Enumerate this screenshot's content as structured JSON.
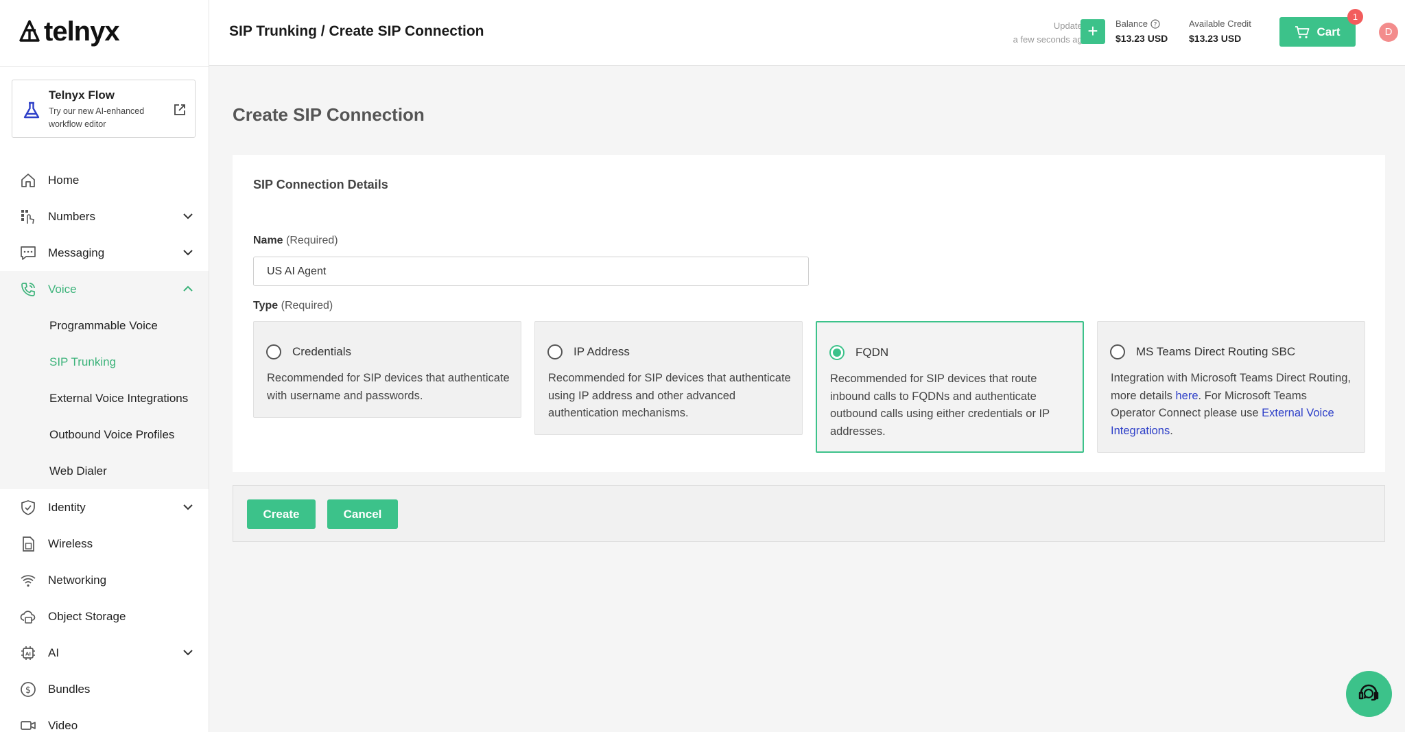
{
  "brand": {
    "name": "telnyx",
    "accent": "#3cc28a",
    "link_color": "#2d3fc8"
  },
  "flow_card": {
    "title": "Telnyx Flow",
    "subtitle": "Try our new AI-enhanced workflow editor",
    "icon": "flask-icon"
  },
  "sidebar": {
    "items": [
      {
        "label": "Home",
        "icon": "home-icon"
      },
      {
        "label": "Numbers",
        "icon": "numbers-icon"
      },
      {
        "label": "Messaging",
        "icon": "message-icon"
      },
      {
        "label": "Voice",
        "icon": "phone-icon"
      },
      {
        "label": "Identity",
        "icon": "shield-check-icon"
      },
      {
        "label": "Wireless",
        "icon": "sim-card-icon"
      },
      {
        "label": "Networking",
        "icon": "wifi-icon"
      },
      {
        "label": "Object Storage",
        "icon": "storage-icon"
      },
      {
        "label": "AI",
        "icon": "ai-chip-icon"
      },
      {
        "label": "Bundles",
        "icon": "dollar-circle-icon"
      },
      {
        "label": "Video",
        "icon": "video-icon"
      }
    ],
    "voice_sub": [
      "Programmable Voice",
      "SIP Trunking",
      "External Voice Integrations",
      "Outbound Voice Profiles",
      "Web Dialer"
    ]
  },
  "topbar": {
    "breadcrumb": "SIP Trunking / Create SIP Connection",
    "updated_label": "Updated",
    "updated_value": "a few seconds ago",
    "add_funds": "+",
    "balance_label": "Balance",
    "balance_value": "$13.23 USD",
    "credit_label": "Available Credit",
    "credit_value": "$13.23 USD",
    "cart_label": "Cart",
    "cart_count": "1",
    "avatar_initial": "D"
  },
  "main": {
    "page_title": "Create SIP Connection",
    "section_title": "SIP Connection Details",
    "name_label": "Name",
    "name_required": "(Required)",
    "name_value": "US AI Agent",
    "type_label": "Type",
    "type_required": "(Required)",
    "selected_type": "FQDN",
    "types": [
      {
        "title": "Credentials",
        "desc": "Recommended for SIP devices that authenticate with username and passwords."
      },
      {
        "title": "IP Address",
        "desc": "Recommended for SIP devices that authenticate using IP address and other advanced authentication mechanisms."
      },
      {
        "title": "FQDN",
        "desc": "Recommended for SIP devices that route inbound calls to FQDNs and authenticate outbound calls using either credentials or IP addresses."
      },
      {
        "title": "MS Teams Direct Routing SBC",
        "desc_part1": "Integration with Microsoft Teams Direct Routing, more details ",
        "link1": "here",
        "desc_part2": ". For Microsoft Teams Operator Connect please use ",
        "link2": "External Voice Integrations",
        "desc_part3": "."
      }
    ],
    "create_label": "Create",
    "cancel_label": "Cancel"
  }
}
